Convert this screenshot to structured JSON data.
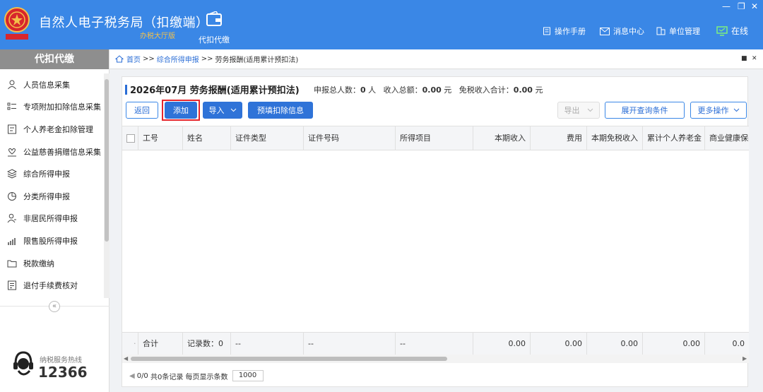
{
  "colors": {
    "header_bg": "#3a87e6",
    "accent": "#2f73d8",
    "highlight": "#e6262c",
    "sub_title": "#f3c04a"
  },
  "app": {
    "title": "自然人电子税务局（扣缴端）",
    "subtitle": "办税大厅版"
  },
  "module": {
    "label": "代扣代缴",
    "icon": "wallet-icon"
  },
  "header_links": {
    "manual": "操作手册",
    "messages": "消息中心",
    "org": "单位管理",
    "status": "在线"
  },
  "sidebar": {
    "title": "代扣代缴",
    "items": [
      {
        "label": "人员信息采集",
        "icon": "person-icon"
      },
      {
        "label": "专项附加扣除信息采集",
        "icon": "list-icon"
      },
      {
        "label": "个人养老金扣除管理",
        "icon": "card-icon"
      },
      {
        "label": "公益慈善捐赠信息采集",
        "icon": "charity-icon"
      },
      {
        "label": "综合所得申报",
        "icon": "layers-icon"
      },
      {
        "label": "分类所得申报",
        "icon": "pie-icon"
      },
      {
        "label": "非居民所得申报",
        "icon": "person-outline-icon"
      },
      {
        "label": "限售股所得申报",
        "icon": "bar-chart-icon"
      },
      {
        "label": "税款缴纳",
        "icon": "folder-icon"
      },
      {
        "label": "退付手续费核对",
        "icon": "document-icon"
      }
    ],
    "collapse": "«",
    "hotline_label": "纳税服务热线",
    "hotline_number": "12366"
  },
  "breadcrumb": {
    "home": "首页",
    "sep1": ">>",
    "level1": "综合所得申报",
    "sep2": ">>",
    "current": "劳务报酬(适用累计预扣法)"
  },
  "panel": {
    "title": "2026年07月 劳务报酬(适用累计预扣法)",
    "stats": {
      "count_label": "申报总人数：",
      "count": "0",
      "count_unit": "人",
      "income_label": "收入总额：",
      "income": "0.00",
      "income_unit": "元",
      "exempt_label": "免税收入合计：",
      "exempt": "0.00",
      "exempt_unit": "元"
    }
  },
  "toolbar": {
    "back": "返回",
    "add": "添加",
    "import": "导入",
    "prefill": "预填扣除信息",
    "export": "导出",
    "expand": "展开查询条件",
    "more": "更多操作"
  },
  "table": {
    "headers": [
      "工号",
      "姓名",
      "证件类型",
      "证件号码",
      "所得项目",
      "本期收入",
      "费用",
      "本期免税收入",
      "累计个人养老金",
      "商业健康保险"
    ],
    "footer": {
      "dot": "·",
      "total": "合计",
      "records": "记录数：0",
      "dash1": "--",
      "dash2": "--",
      "dash3": "--",
      "v1": "0.00",
      "v2": "0.00",
      "v3": "0.00",
      "v4": "0.00",
      "v5": "0.0"
    }
  },
  "pager": {
    "pos": "0/0",
    "records": "共0条记录",
    "per_page_label": "每页显示条数",
    "per_page": "1000"
  }
}
